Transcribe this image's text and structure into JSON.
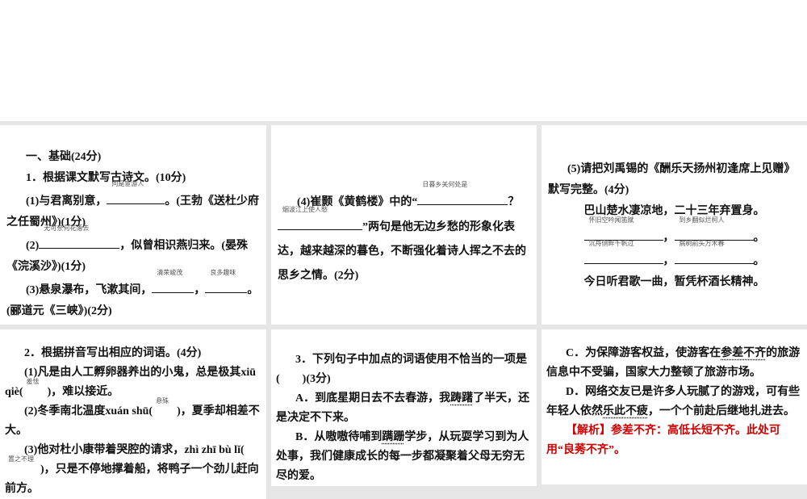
{
  "panel1": {
    "section": "一、基础(24分)",
    "q1": "1．根据课文默写古诗文。(10分)",
    "s1_pre": "(1)与君离别意，",
    "s1_ans": "同是宦游人",
    "s1_post": "。(王勃《送杜少府之任蜀州》)(1分)",
    "s2_pre": "(2)",
    "s2_ans": "无可奈何花落去",
    "s2_post": "，似曾相识燕归来。(晏殊《浣溪沙》)(1分)",
    "s3_pre": "(3)悬泉瀑布，飞漱其间，",
    "s3_ans1": "清荣峻茂",
    "s3_mid": "，",
    "s3_ans2": "良多趣味",
    "s3_post": "。(郦道元《三峡》)(2分)"
  },
  "panel2": {
    "pre": "(4)崔颢《黄鹤楼》中的“",
    "ans1": "日暮乡关何处是",
    "mid": "？",
    "ans2": "烟波江上使人愁",
    "post": "”两句是他无边乡愁的形象化表达，越来越深的暮色，不断强化着诗人挥之不去的思乡之情。(2分)"
  },
  "panel3": {
    "intro": "(5)请把刘禹锡的《酬乐天扬州初逢席上见赠》默写完整。(4分)",
    "line1": "巴山楚水凄凉地，二十三年弃置身。",
    "a1": "怀旧空吟闻笛赋",
    "a2": "到乡翻似烂柯人",
    "a3": "沉舟侧畔千帆过",
    "a4": "病树前头万木春",
    "comma": "，",
    "period": "。",
    "line4": "今日听君歌一曲，暂凭杯酒长精神。"
  },
  "panel4": {
    "q2": "2．根据拼音写出相应的词语。(4分)",
    "s1_pre": "(1)凡是由人工孵卵器养出的小鬼，总是极其xiū qiè(",
    "s1_ans": "羞怯",
    "s1_post": ")，难以接近。",
    "s2_pre": "(2)冬季南北温度xuán shū(",
    "s2_ans": "悬殊",
    "s2_post": ")，夏季却相差不大。",
    "s3_pre": "(3)他对杜小康带着哭腔的请求，zhì zhī bù lǐ(",
    "s3_ans": "置之不理",
    "s3_post": ")，只是不停地撑着船，将鸭子一个劲儿赶向前方。"
  },
  "panel5": {
    "q3": "3．下列句子中加点的词语使用不恰当的一项是(　　)(3分)",
    "a_pre": "A．到底星期日去不去春游，我",
    "a_dot": "踌躇",
    "a_post": "了半天，还是决定不下来。",
    "b_pre": "B．从嗷嗷待哺到",
    "b_dot": "蹒跚",
    "b_post": "学步，从玩耍学习到为人处事，我们健康成长的每一步都凝聚着父母无穷无尽的爱。"
  },
  "panel6": {
    "c_pre": "C．为保障游客权益，使游客在",
    "c_dot": "参差不齐",
    "c_post": "的旅游信息中不受骗，国家大力整顿了旅游市场。",
    "d_pre": "D．网络交友已是许多人玩腻了的游戏，可有些年轻人依然",
    "d_dot": "乐此不疲",
    "d_post": "，一个个前赴后继地扎进去。",
    "analysis": "【解析】参差不齐：高低长短不齐。此处可用“良莠不齐”。"
  }
}
